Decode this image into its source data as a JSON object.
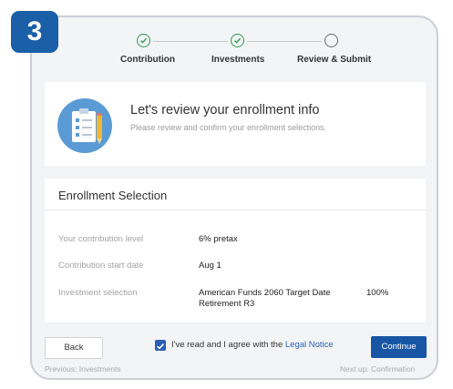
{
  "step_number": "3",
  "stepper": [
    {
      "label": "Contribution",
      "state": "done"
    },
    {
      "label": "Investments",
      "state": "done"
    },
    {
      "label": "Review & Submit",
      "state": "current"
    }
  ],
  "intro": {
    "title": "Let's review your enrollment info",
    "subtitle": "Please review and confirm your enrollment selections.",
    "icon": "checklist-clipboard-icon"
  },
  "enrollment": {
    "title": "Enrollment Selection",
    "rows": [
      {
        "label": "Your contribution level",
        "value": "6% pretax"
      },
      {
        "label": "Contribution start date",
        "value": "Aug 1"
      },
      {
        "label": "Investment selection",
        "value": "American Funds 2060 Target Date Retirement R3",
        "percent": "100%"
      }
    ]
  },
  "footer": {
    "back_label": "Back",
    "agree_text": "I've read and I agree with the",
    "legal_link": "Legal Notice",
    "agree_checked": true,
    "continue_label": "Continue",
    "previous_text": "Previous: Investments",
    "next_text": "Next up: Confirmation"
  },
  "colors": {
    "badge": "#1b5fa8",
    "step_done": "#2e9b4b",
    "primary_button": "#1856a5",
    "link": "#2a5fb5",
    "icon_circle": "#5b9bd5"
  }
}
